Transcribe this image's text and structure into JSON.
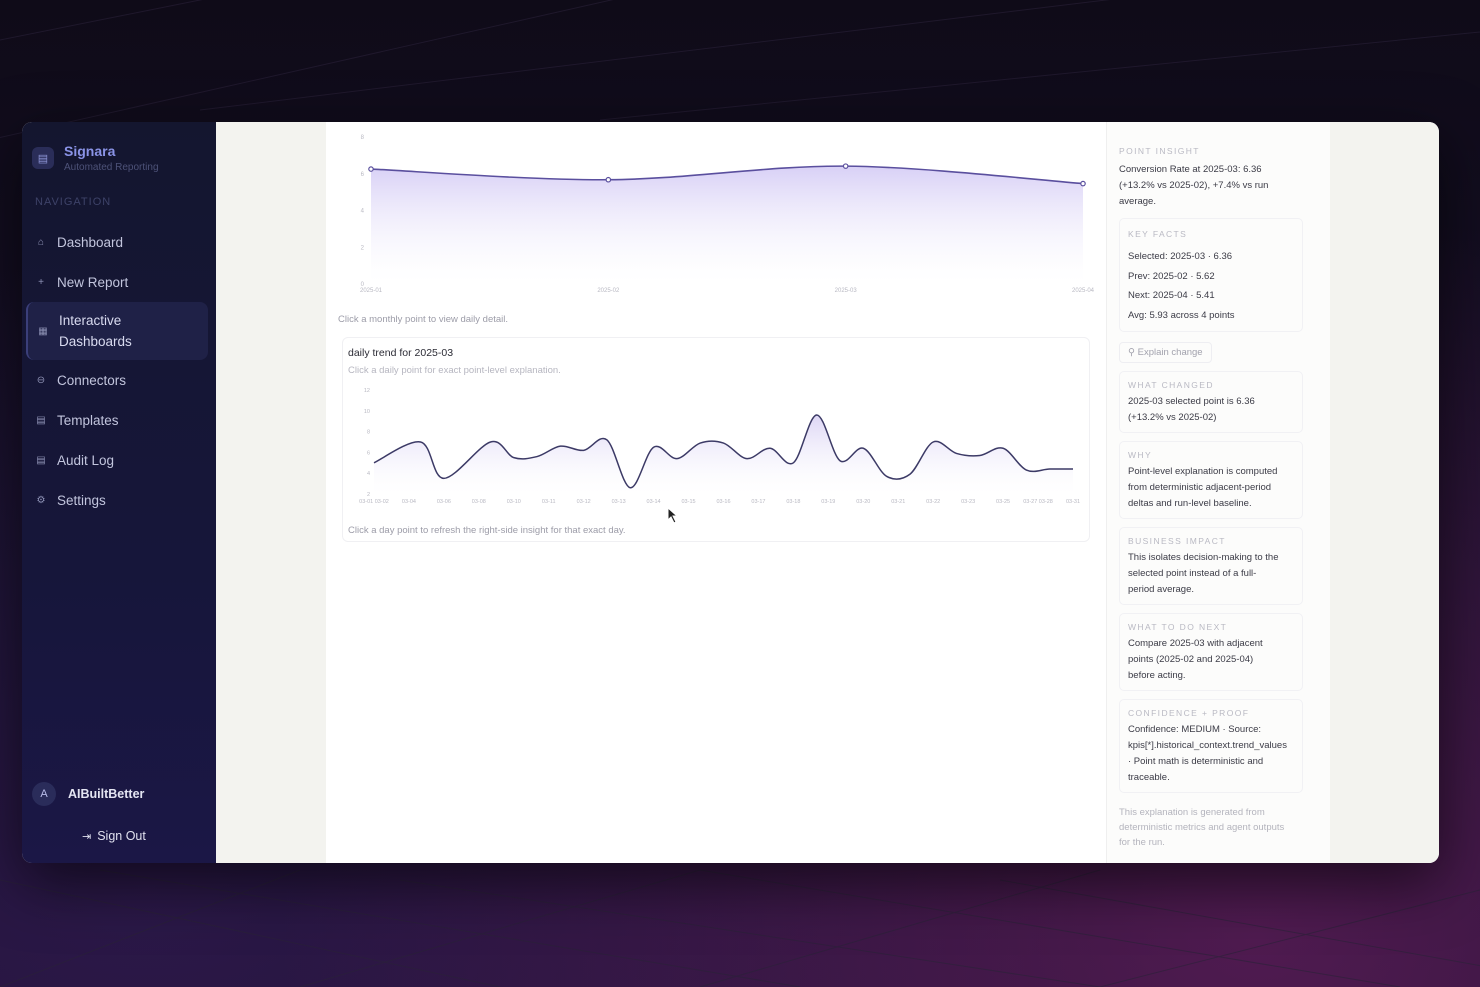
{
  "brand": {
    "name": "Signara",
    "subtitle": "Automated Reporting",
    "logo_icon": "document-icon"
  },
  "sidebar": {
    "heading": "NAVIGATION",
    "items": [
      {
        "label": "Dashboard",
        "icon": "home-icon",
        "glyph": "⌂"
      },
      {
        "label": "New Report",
        "icon": "plus-icon",
        "glyph": "+"
      },
      {
        "label_lines": [
          "Interactive",
          "Dashboards"
        ],
        "icon": "grid-icon",
        "glyph": "▦",
        "active": true
      },
      {
        "label": "Connectors",
        "icon": "connector-icon",
        "glyph": "⊖"
      },
      {
        "label": "Templates",
        "icon": "template-icon",
        "glyph": "▤"
      },
      {
        "label": "Audit Log",
        "icon": "document-icon",
        "glyph": "▤"
      },
      {
        "label": "Settings",
        "icon": "gear-icon",
        "glyph": "⚙"
      }
    ]
  },
  "user": {
    "initial": "A",
    "name": "AIBuiltBetter"
  },
  "signout": {
    "label": "Sign Out",
    "icon": "sign-out-icon"
  },
  "main": {
    "monthly_caption": "Click a monthly point to view daily detail.",
    "daily_title": "daily trend for 2025-03",
    "daily_subtitle": "Click a daily point for exact point-level explanation.",
    "daily_caption": "Click a day point to refresh the right-side insight for that exact day."
  },
  "chart_data": [
    {
      "type": "area",
      "x": [
        "2025-01",
        "2025-02",
        "2025-03",
        "2025-04"
      ],
      "series": [
        {
          "values": [
            6.2,
            5.62,
            6.36,
            5.41
          ]
        }
      ],
      "ylim": [
        0,
        8
      ],
      "yticks": [
        "0",
        "2",
        "4",
        "6",
        "8"
      ],
      "color": "#5a4f9e",
      "fill": "#d8d0f6"
    },
    {
      "type": "area",
      "title": "daily trend for 2025-03",
      "x_ticks": [
        "03-01 03-02",
        "03-04",
        "03-06",
        "03-08",
        "03-10",
        "03-11",
        "03-12",
        "03-13",
        "03-14",
        "03-15",
        "03-16",
        "03-17",
        "03-18",
        "03-19",
        "03-20",
        "03-21",
        "03-22",
        "03-23",
        "03-25",
        "03-27 03-28",
        "03-31"
      ],
      "x": [
        1,
        3,
        4,
        6,
        7,
        8,
        9,
        10,
        11,
        12,
        13,
        14,
        15,
        16,
        17,
        18,
        19,
        20,
        21,
        22,
        23,
        24,
        25,
        26,
        27,
        28,
        29,
        30,
        31
      ],
      "series": [
        {
          "values": [
            5.0,
            7.0,
            3.5,
            7.0,
            5.5,
            5.6,
            6.6,
            6.2,
            7.2,
            2.6,
            6.5,
            5.4,
            6.9,
            6.9,
            5.4,
            6.4,
            5.0,
            9.6,
            5.2,
            6.4,
            3.7,
            3.9,
            7.0,
            5.9,
            5.7,
            6.4,
            4.3,
            4.4,
            4.4
          ]
        }
      ],
      "ylim": [
        2,
        12
      ],
      "yticks": [
        "2",
        "4",
        "6",
        "8",
        "10",
        "12"
      ],
      "color": "#3c3a66",
      "fill": "#ddd6f5"
    }
  ],
  "insight": {
    "heading": "POINT INSIGHT",
    "summary": [
      "Conversion Rate at 2025-03: 6.36",
      "(+13.2% vs 2025-02), +7.4% vs run",
      "average."
    ],
    "key_facts_heading": "KEY FACTS",
    "key_facts": [
      "Selected: 2025-03 · 6.36",
      "Prev: 2025-02 · 5.62",
      "Next: 2025-04 · 5.41",
      "Avg: 5.93 across 4 points"
    ],
    "explain_button": "Explain change",
    "explain_icon": "search-icon",
    "sections": [
      {
        "heading": "WHAT CHANGED",
        "lines": [
          "2025-03 selected point is 6.36",
          "(+13.2% vs 2025-02)"
        ]
      },
      {
        "heading": "WHY",
        "lines": [
          "Point-level explanation is computed",
          "from deterministic adjacent-period",
          "deltas and run-level baseline."
        ]
      },
      {
        "heading": "BUSINESS IMPACT",
        "lines": [
          "This isolates decision-making to the",
          "selected point instead of a full-",
          "period average."
        ]
      },
      {
        "heading": "WHAT TO DO NEXT",
        "lines": [
          "Compare 2025-03 with adjacent",
          "points (2025-02 and 2025-04)",
          "before acting."
        ]
      },
      {
        "heading": "CONFIDENCE + PROOF",
        "lines": [
          "Confidence: MEDIUM · Source:",
          "kpis[*].historical_context.trend_values",
          "· Point math is deterministic and",
          "traceable."
        ]
      }
    ],
    "footer": [
      "This explanation is generated from",
      "deterministic metrics and agent outputs",
      "for the run."
    ]
  }
}
